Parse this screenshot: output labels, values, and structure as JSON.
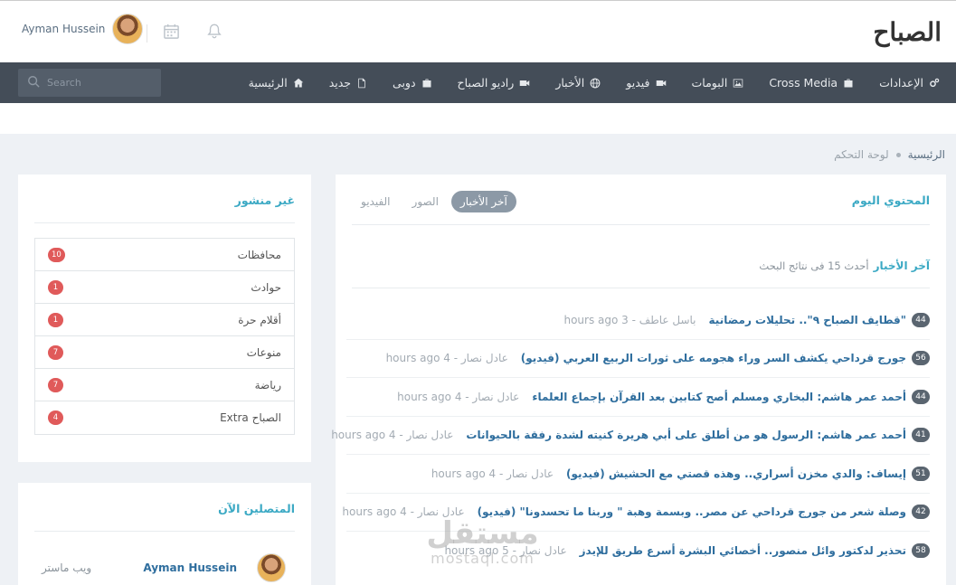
{
  "header": {
    "user_name": "Ayman Hussein",
    "logo_text": "الصباح",
    "calendar_icon": "calendar-icon",
    "bell_icon": "bell-icon"
  },
  "nav": {
    "search_placeholder": "Search",
    "items": [
      {
        "label": "الرئيسية",
        "icon": "home-icon"
      },
      {
        "label": "جديد",
        "icon": "file-icon"
      },
      {
        "label": "دوبى",
        "icon": "briefcase-icon"
      },
      {
        "label": "راديو الصباح",
        "icon": "video-icon"
      },
      {
        "label": "الأخبار",
        "icon": "globe-icon"
      },
      {
        "label": "فيديو",
        "icon": "video-icon"
      },
      {
        "label": "البومات",
        "icon": "image-icon"
      },
      {
        "label": "Cross Media",
        "icon": "briefcase-icon"
      },
      {
        "label": "الإعدادات",
        "icon": "gears-icon"
      }
    ]
  },
  "breadcrumb": {
    "home": "الرئيسية",
    "current": "لوحة التحكم"
  },
  "main_panel": {
    "title": "المحتوي اليوم",
    "tabs": [
      {
        "label": "آخر الأخبار",
        "active": true
      },
      {
        "label": "الصور",
        "active": false
      },
      {
        "label": "الفيديو",
        "active": false
      }
    ],
    "news_heading": "آخر الأخبار",
    "news_subheading": "أحدث 15 فى نتائج البحث",
    "news": [
      {
        "count": "44",
        "title": "\"قطايف الصباح ٩\".. تحليلات رمضانية",
        "meta": "باسل عاطف - 3 hours ago"
      },
      {
        "count": "56",
        "title": "جورج قرداحي يكشف السر وراء هجومه على ثورات الربيع العربي (فيديو)",
        "meta": "عادل نصار - 4 hours ago"
      },
      {
        "count": "44",
        "title": "أحمد عمر هاشم: البخاري ومسلم أصح كتابين بعد القرآن بإجماع العلماء",
        "meta": "عادل نصار - 4 hours ago"
      },
      {
        "count": "41",
        "title": "أحمد عمر هاشم: الرسول هو من أطلق على أبي هريرة كنيته لشدة رفقة بالحيوانات",
        "meta": "عادل نصار - 4 hours ago"
      },
      {
        "count": "51",
        "title": "إيساف: والدي مخزن أسراري.. وهذه قصتي مع الحشيش (فيديو)",
        "meta": "عادل نصار - 4 hours ago"
      },
      {
        "count": "42",
        "title": "وصلة شعر من جورج قرداحي عن مصر.. وبسمة وهبة \" وربنا ما تحسدونا\" (فيديو)",
        "meta": "عادل نصار - 4 hours ago"
      },
      {
        "count": "58",
        "title": "تحذير لدكتور وائل منصور.. أخصائي البشرة أسرع طريق للإيدز",
        "meta": "عادل نصار - 5 hours ago"
      }
    ]
  },
  "unpublished_panel": {
    "title": "غير منشور",
    "categories": [
      {
        "label": "محافظات",
        "count": "10"
      },
      {
        "label": "حوادث",
        "count": "1"
      },
      {
        "label": "أقلام حرة",
        "count": "1"
      },
      {
        "label": "منوعات",
        "count": "7"
      },
      {
        "label": "رياضة",
        "count": "7"
      },
      {
        "label": "الصباح Extra",
        "count": "4"
      }
    ]
  },
  "online_panel": {
    "title": "المتصلين الآن",
    "users": [
      {
        "name": "Ayman Hussein",
        "role": "ويب ماستر"
      }
    ]
  },
  "watermark": {
    "arabic": "مستقل",
    "latin": "mostaql.com"
  },
  "colors": {
    "navbar": "#444d58",
    "accent": "#3ba9c4",
    "link": "#2f6e9e",
    "badge_red": "#e05a5a"
  }
}
